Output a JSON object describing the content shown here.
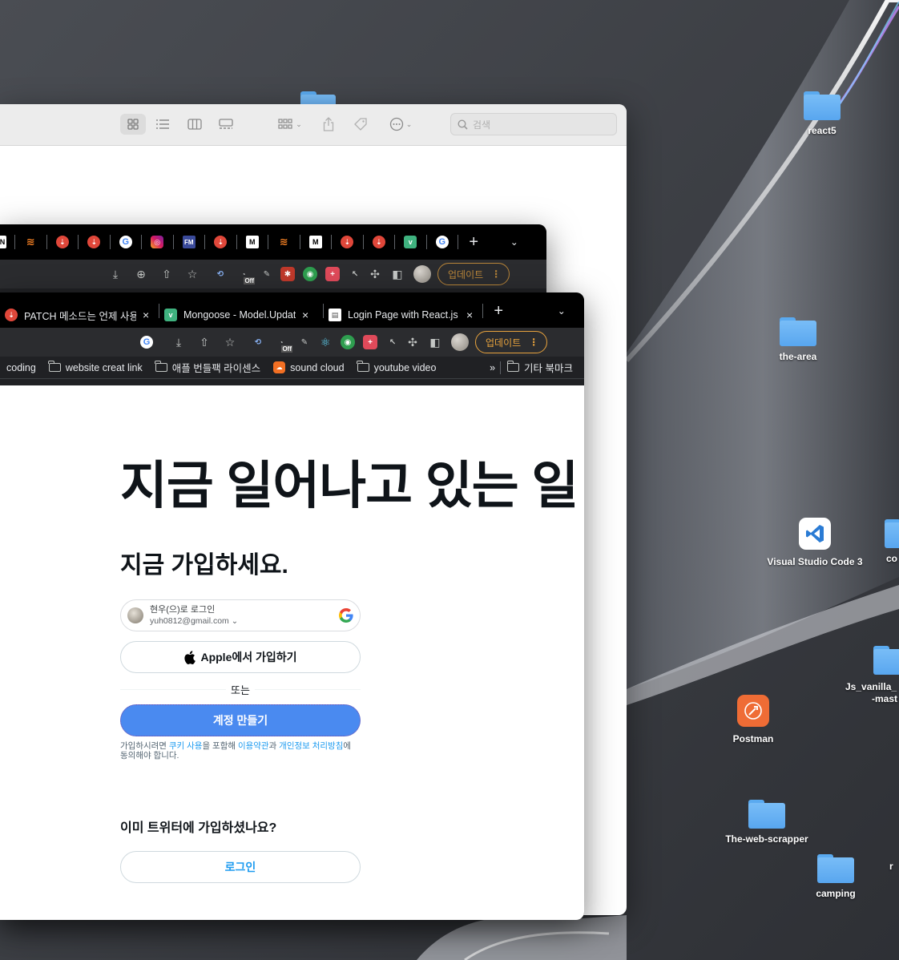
{
  "desktop": {
    "items": [
      {
        "label": "react5",
        "kind": "folder"
      },
      {
        "label": "the-area",
        "kind": "folder"
      },
      {
        "label": "Visual Studio Code 3",
        "kind": "app"
      },
      {
        "label": "co",
        "kind": "folder"
      },
      {
        "label": "Js_vanilla_",
        "label2": "-mast",
        "kind": "folder"
      },
      {
        "label": "Postman",
        "kind": "app"
      },
      {
        "label": "The-web-scrapper",
        "kind": "folder"
      },
      {
        "label": "camping",
        "kind": "folder"
      },
      {
        "label": "r",
        "kind": "folder"
      }
    ]
  },
  "finder": {
    "search_placeholder": "검색"
  },
  "chrome_back": {
    "update_label": "업데이트",
    "off_badge": "Off"
  },
  "chrome_front": {
    "tabs": [
      {
        "title": "PATCH 메소드는 언제 사용해",
        "favicon": "red-circle"
      },
      {
        "title": "Mongoose - Model.Update",
        "favicon": "v-green"
      },
      {
        "title": "Login Page with React.js",
        "favicon": "doc"
      }
    ],
    "new_tab": "+",
    "update_label": "업데이트",
    "off_badge": "Off",
    "bookmarks": [
      {
        "label": "coding",
        "icon": "none"
      },
      {
        "label": "website creat link",
        "icon": "folder"
      },
      {
        "label": "애플 번들팩 라이센스",
        "icon": "folder"
      },
      {
        "label": "sound cloud",
        "icon": "soundcloud"
      },
      {
        "label": "youtube video",
        "icon": "folder"
      }
    ],
    "bookmarks_more": "»",
    "other_bookmarks": "기타 북마크"
  },
  "twitter": {
    "hero": "지금 일어나고 있는 일",
    "join_heading": "지금 가입하세요.",
    "google_name": "현우(으)로 로그인",
    "google_email": "yuh0812@gmail.com",
    "apple_label": "Apple에서 가입하기",
    "or_label": "또는",
    "create_label": "계정 만들기",
    "terms": {
      "prefix": "가입하시려면 ",
      "cookie": "쿠키 사용",
      "mid1": "을 포함해 ",
      "tos": "이용약관",
      "mid2": "과 ",
      "privacy": "개인정보 처리방침",
      "suffix": "에 동의해야 합니다."
    },
    "already_heading": "이미 트위터에 가입하셨나요?",
    "login_label": "로그인"
  },
  "colors": {
    "twitter_blue": "#1d9bf0",
    "create_button": "#4a8af0",
    "update_orange": "#e8a33d"
  }
}
